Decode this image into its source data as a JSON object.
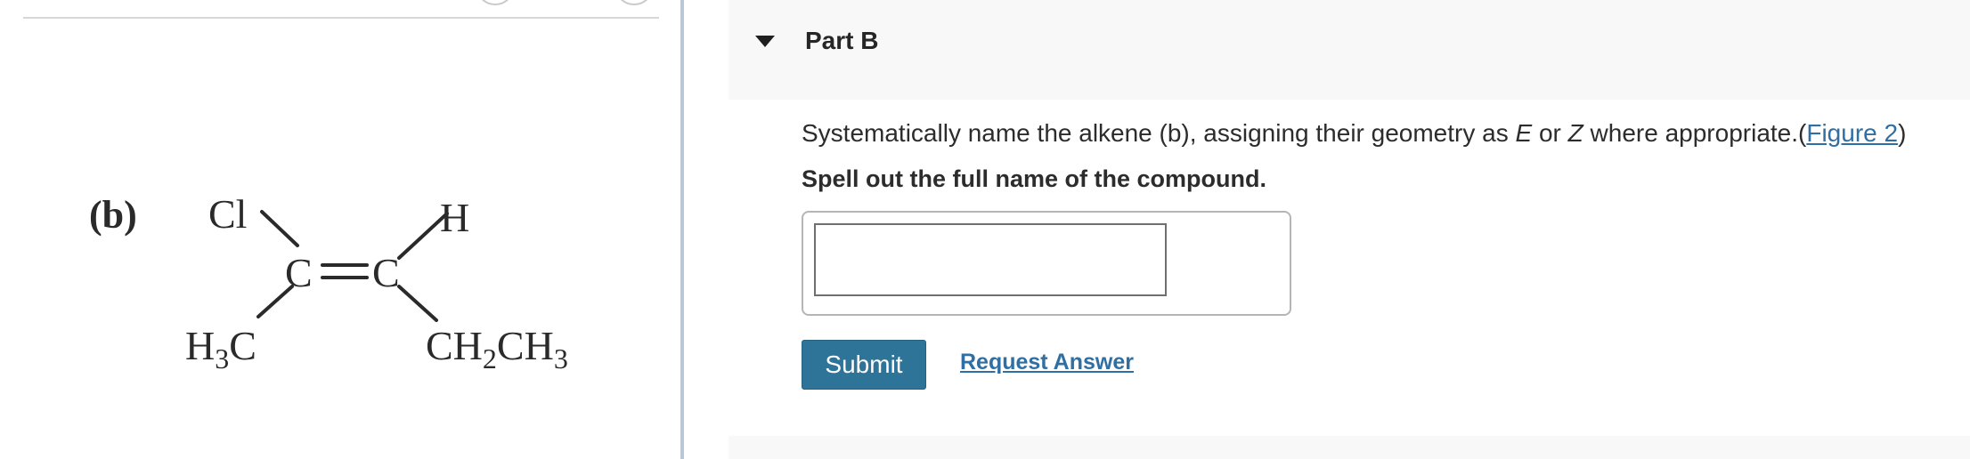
{
  "figure": {
    "label": "(b)",
    "atoms": {
      "cl": "Cl",
      "h": "H",
      "c_left": "C",
      "c_right": "C",
      "ch3_left": {
        "base": "H",
        "sub": "3",
        "tail": "C"
      },
      "ethyl": {
        "a": "CH",
        "sub1": "2",
        "b": "CH",
        "sub2": "3"
      }
    }
  },
  "part": {
    "title": "Part B",
    "question": {
      "prefix": "Systematically name the alkene (b), assigning their geometry as ",
      "e": "E",
      "or": " or ",
      "z": "Z",
      "suffix": " where appropriate.(",
      "link": "Figure 2",
      "close": ")"
    },
    "instruction": "Spell out the full name of the compound.",
    "answer_value": "",
    "submit_label": "Submit",
    "request_label": "Request Answer"
  }
}
